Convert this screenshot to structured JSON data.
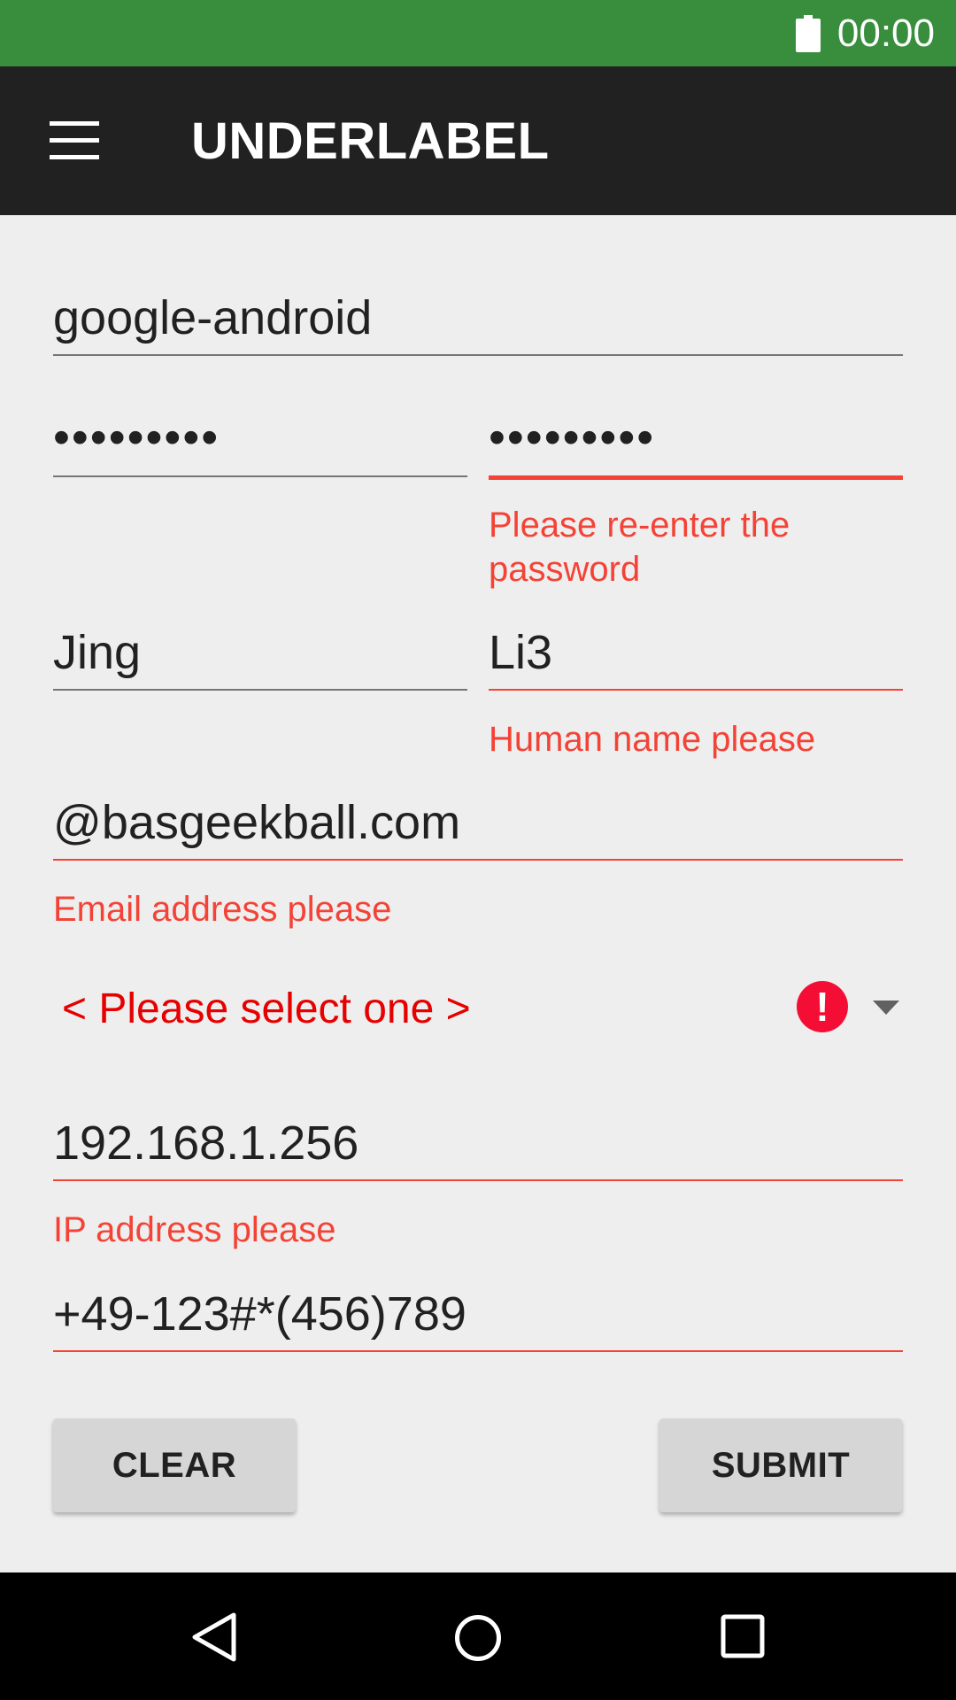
{
  "status_bar": {
    "time": "00:00",
    "battery_icon": "battery-full-icon",
    "color": "#388e3c"
  },
  "app_bar": {
    "title": "UNDERLABEL",
    "menu_icon": "hamburger-menu-icon",
    "color": "#212121"
  },
  "form": {
    "username": {
      "value": "google-android"
    },
    "password": {
      "value": "•••••••••"
    },
    "confirm_password": {
      "value": "•••••••••",
      "error": "Please re-enter the password"
    },
    "first_name": {
      "value": "Jing"
    },
    "last_name": {
      "value": "Li3",
      "error": "Human name please"
    },
    "email": {
      "value": "@basgeekball.com",
      "error": "Email address please"
    },
    "select": {
      "value": "< Please select one >",
      "error_icon": "!",
      "dropdown_icon": "dropdown-arrow-icon"
    },
    "ip_address": {
      "value": "192.168.1.256",
      "error": "IP address please"
    },
    "phone": {
      "value": "+49-123#*(456)789"
    }
  },
  "buttons": {
    "clear": "CLEAR",
    "submit": "SUBMIT"
  },
  "navigation": {
    "back_icon": "back-icon",
    "home_icon": "home-icon",
    "recents_icon": "recents-icon"
  },
  "colors": {
    "error": "#f44336",
    "spinner_error": "#e60000",
    "background": "#eeeeee"
  }
}
